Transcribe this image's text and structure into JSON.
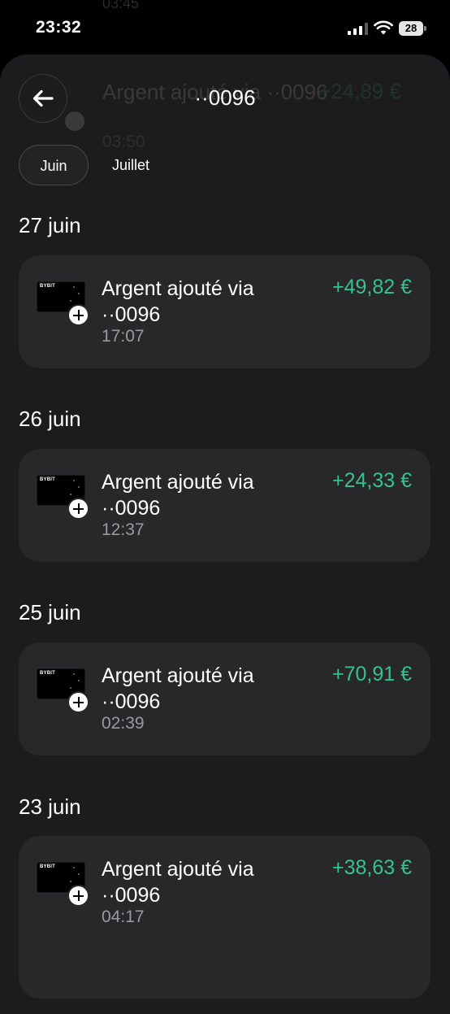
{
  "status_bar": {
    "time": "23:32",
    "battery": "28",
    "ghost_time": "03:45"
  },
  "header": {
    "title": "··0096",
    "back_icon": "arrow-left-icon"
  },
  "ghost_row": {
    "title": "Argent ajouté via ··0096",
    "amount": "+24,89 €",
    "time": "03:50"
  },
  "tabs": [
    {
      "label": "Juin",
      "active": true
    },
    {
      "label": "Juillet",
      "active": false
    }
  ],
  "groups": [
    {
      "date": "27 juin",
      "transactions": [
        {
          "title": "Argent ajouté via ··0096",
          "amount": "+49,82 €",
          "time": "17:07",
          "card_logo": "BYBIT"
        }
      ]
    },
    {
      "date": "26 juin",
      "transactions": [
        {
          "title": "Argent ajouté via ··0096",
          "amount": "+24,33 €",
          "time": "12:37",
          "card_logo": "BYBIT"
        }
      ]
    },
    {
      "date": "25 juin",
      "transactions": [
        {
          "title": "Argent ajouté via ··0096",
          "amount": "+70,91 €",
          "time": "02:39",
          "card_logo": "BYBIT"
        }
      ]
    },
    {
      "date": "23 juin",
      "transactions": [
        {
          "title": "Argent ajouté via ··0096",
          "amount": "+38,63 €",
          "time": "04:17",
          "card_logo": "BYBIT"
        }
      ]
    }
  ],
  "colors": {
    "amount_positive": "#35c28f",
    "sheet_bg": "#1c1c1e",
    "card_bg": "#28282a"
  }
}
